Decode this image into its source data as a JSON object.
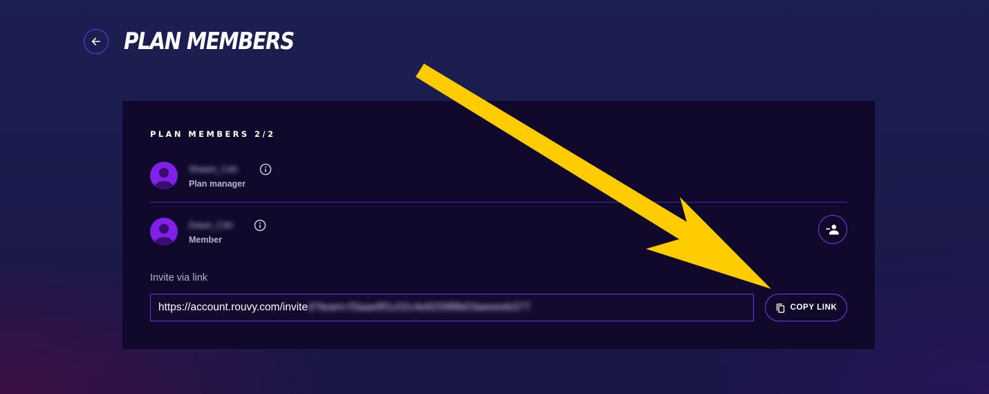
{
  "header": {
    "title": "PLAN MEMBERS"
  },
  "members_section": {
    "heading": "PLAN MEMBERS 2/2",
    "members": [
      {
        "name": "Shawn_Cdn",
        "role": "Plan manager"
      },
      {
        "name": "Dawn_Cdn",
        "role": "Member"
      }
    ]
  },
  "invite": {
    "label": "Invite via link",
    "link_visible": "https://account.rouvy.com/invite",
    "link_token": "d?team=f3aae8f1c02c4e8209f8b03aeeeeb377",
    "copy_button_label": "COPY LINK"
  },
  "colors": {
    "background": "#1b1b4c",
    "card": "#10092b",
    "accent": "#7a3cf0",
    "avatar": "#8120e8",
    "annotation_arrow": "#ffcc00"
  },
  "icons": {
    "back": "arrow-left-icon",
    "info": "info-icon",
    "remove_member": "person-remove-icon",
    "copy": "copy-icon"
  }
}
